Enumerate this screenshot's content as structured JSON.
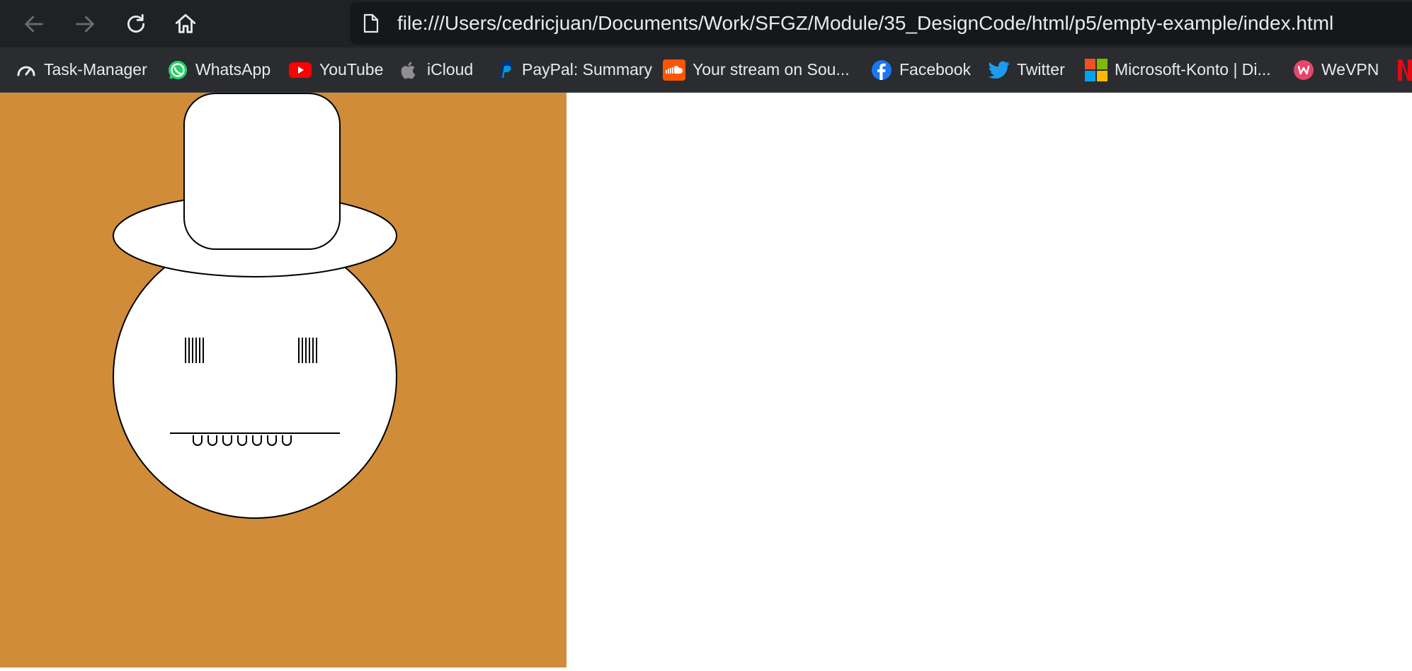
{
  "browser": {
    "url": "file:///Users/cedricjuan/Documents/Work/SFGZ/Module/35_DesignCode/html/p5/empty-example/index.html"
  },
  "bookmarks": [
    {
      "label": "Task-Manager",
      "icon": "speedometer-icon"
    },
    {
      "label": "WhatsApp",
      "icon": "whatsapp-icon"
    },
    {
      "label": "YouTube",
      "icon": "youtube-icon"
    },
    {
      "label": "iCloud",
      "icon": "apple-icon"
    },
    {
      "label": "PayPal: Summary",
      "icon": "paypal-icon"
    },
    {
      "label": "Your stream on Sou...",
      "icon": "soundcloud-icon"
    },
    {
      "label": "Facebook",
      "icon": "facebook-icon"
    },
    {
      "label": "Twitter",
      "icon": "twitter-icon"
    },
    {
      "label": "Microsoft-Konto | Di...",
      "icon": "microsoft-icon"
    },
    {
      "label": "WeVPN",
      "icon": "wevpn-icon"
    }
  ],
  "colors": {
    "canvas_background": "#d08c38",
    "toolbar": "#202124",
    "bookmarks_bar": "#2b2c30"
  }
}
